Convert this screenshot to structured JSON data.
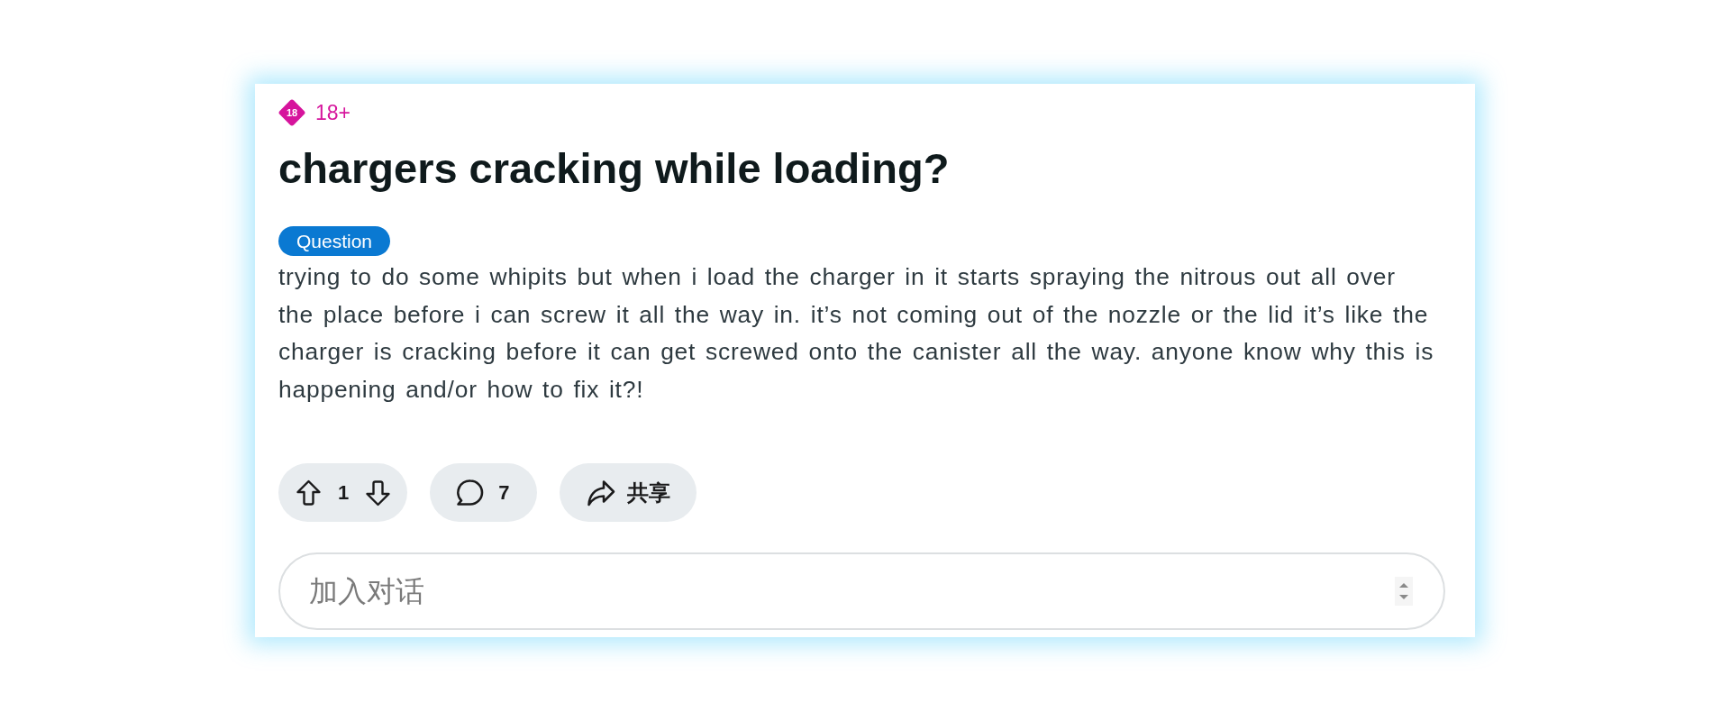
{
  "post": {
    "content_rating": {
      "badge": "18",
      "label": "18+"
    },
    "title": "chargers cracking while loading?",
    "flair": "Question",
    "body": "trying to do some whipits but when i load the charger in it starts spraying the nitrous out all over the place before i can screw it all the way in. it’s not coming out of the nozzle or the lid it’s like the charger is cracking before it can get screwed onto the canister all the way. anyone know why this is happening and/or how to fix it?!",
    "actions": {
      "score": "1",
      "comments": "7",
      "share": "共享"
    }
  },
  "comment_field": {
    "placeholder": "加入对话"
  }
}
